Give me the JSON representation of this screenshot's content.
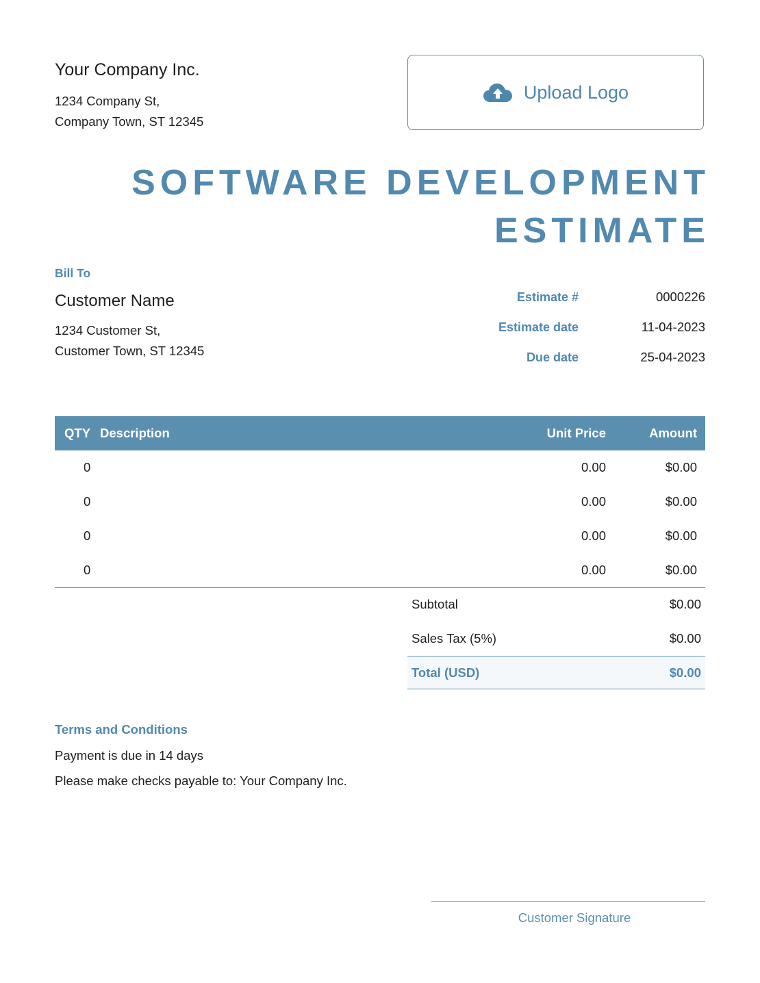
{
  "company": {
    "name": "Your Company Inc.",
    "address_line1": "1234 Company St,",
    "address_line2": "Company Town, ST 12345"
  },
  "upload_logo": {
    "label": "Upload Logo",
    "icon": "cloud-upload-icon"
  },
  "title": {
    "line1": "SOFTWARE DEVELOPMENT",
    "line2": "ESTIMATE"
  },
  "bill_to": {
    "label": "Bill To",
    "name": "Customer Name",
    "address_line1": "1234 Customer St,",
    "address_line2": "Customer Town, ST 12345"
  },
  "meta": {
    "estimate_number_label": "Estimate #",
    "estimate_number": "0000226",
    "estimate_date_label": "Estimate date",
    "estimate_date": "11-04-2023",
    "due_date_label": "Due date",
    "due_date": "25-04-2023"
  },
  "table": {
    "headers": {
      "qty": "QTY",
      "description": "Description",
      "unit_price": "Unit Price",
      "amount": "Amount"
    },
    "rows": [
      {
        "qty": "0",
        "description": "",
        "unit_price": "0.00",
        "amount": "$0.00"
      },
      {
        "qty": "0",
        "description": "",
        "unit_price": "0.00",
        "amount": "$0.00"
      },
      {
        "qty": "0",
        "description": "",
        "unit_price": "0.00",
        "amount": "$0.00"
      },
      {
        "qty": "0",
        "description": "",
        "unit_price": "0.00",
        "amount": "$0.00"
      }
    ]
  },
  "totals": {
    "subtotal_label": "Subtotal",
    "subtotal": "$0.00",
    "tax_label": "Sales Tax (5%)",
    "tax": "$0.00",
    "total_label": "Total (USD)",
    "total": "$0.00"
  },
  "terms": {
    "title": "Terms and Conditions",
    "line1": "Payment is due in 14 days",
    "line2": "Please make checks payable to: Your Company Inc."
  },
  "signature": {
    "label": "Customer Signature"
  },
  "colors": {
    "accent": "#5a8fb0",
    "accent_text": "#5189af",
    "text": "#1f1f1f"
  }
}
